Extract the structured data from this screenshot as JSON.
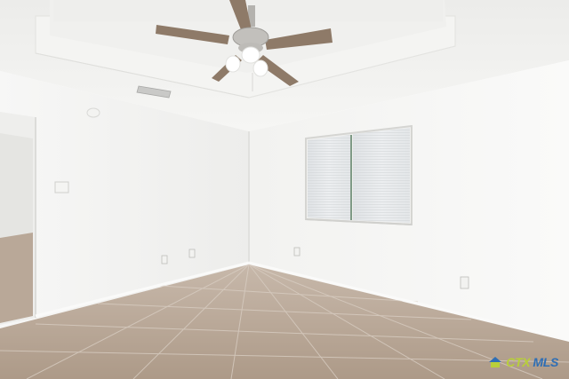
{
  "scene": {
    "description_colors": {
      "wall": "#f3f3f1",
      "wall_shadow": "#e7e7e4",
      "ceiling": "#efefed",
      "tray": "#f7f7f5",
      "floor_tile": "#b7a696",
      "grout": "#d6cbbf",
      "blinds": "#e6e8ea"
    }
  },
  "watermark": {
    "brand_prefix": "CTX",
    "brand_suffix": "MLS",
    "icon": "house-logo-icon",
    "prefix_color": "#b8cf3a",
    "suffix_color": "#2e6eb5"
  }
}
